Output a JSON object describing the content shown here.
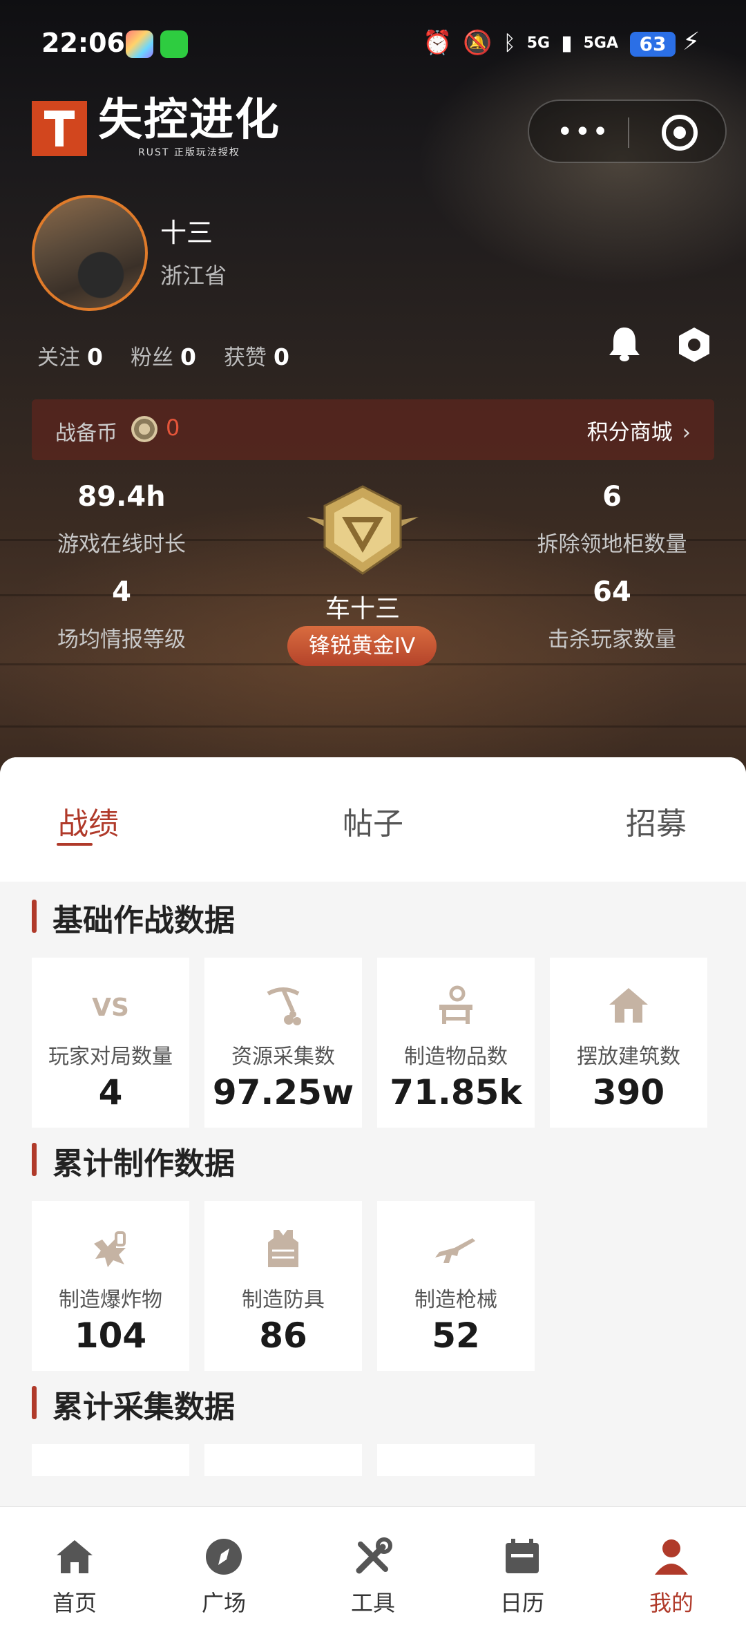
{
  "status": {
    "time": "22:06",
    "signal1": "5G",
    "signal2": "5GA",
    "battery": "63"
  },
  "header": {
    "logo_title": "失控进化",
    "logo_sub": "RUST 正版玩法授权"
  },
  "profile": {
    "name": "十三",
    "region": "浙江省",
    "follow_label": "关注",
    "follow_count": "0",
    "fans_label": "粉丝",
    "fans_count": "0",
    "likes_label": "获赞",
    "likes_count": "0"
  },
  "coins": {
    "label": "战备币",
    "value": "0",
    "shop_label": "积分商城",
    "shop_chevron": "›"
  },
  "stats": {
    "online_hours": {
      "value": "89.4h",
      "label": "游戏在线时长"
    },
    "cabinets": {
      "value": "6",
      "label": "拆除领地柜数量"
    },
    "intel_level": {
      "value": "4",
      "label": "场均情报等级"
    },
    "kills": {
      "value": "64",
      "label": "击杀玩家数量"
    }
  },
  "rank": {
    "player_name": "车十三",
    "tier": "锋锐黄金IV"
  },
  "tabs": [
    {
      "label": "战绩"
    },
    {
      "label": "帖子"
    },
    {
      "label": "招募"
    }
  ],
  "sections": {
    "combat": {
      "title": "基础作战数据",
      "cards": [
        {
          "icon": "vs-icon",
          "label": "玩家对局数量",
          "value": "4"
        },
        {
          "icon": "pickaxe-icon",
          "label": "资源采集数",
          "value": "97.25w"
        },
        {
          "icon": "workbench-icon",
          "label": "制造物品数",
          "value": "71.85k"
        },
        {
          "icon": "house-icon",
          "label": "摆放建筑数",
          "value": "390"
        }
      ]
    },
    "crafting": {
      "title": "累计制作数据",
      "cards": [
        {
          "icon": "explosive-icon",
          "label": "制造爆炸物",
          "value": "104"
        },
        {
          "icon": "armor-vest-icon",
          "label": "制造防具",
          "value": "86"
        },
        {
          "icon": "rifle-icon",
          "label": "制造枪械",
          "value": "52"
        }
      ]
    },
    "gathering": {
      "title": "累计采集数据"
    }
  },
  "nav": [
    {
      "label": "首页",
      "icon": "home-icon"
    },
    {
      "label": "广场",
      "icon": "compass-icon"
    },
    {
      "label": "工具",
      "icon": "tools-icon"
    },
    {
      "label": "日历",
      "icon": "calendar-icon"
    },
    {
      "label": "我的",
      "icon": "profile-icon",
      "active": true
    }
  ],
  "colors": {
    "accent": "#b03a2a",
    "coin_value": "#e4553a",
    "rank_pill": "#c9522f",
    "icon_tan": "#c5b3a3"
  }
}
